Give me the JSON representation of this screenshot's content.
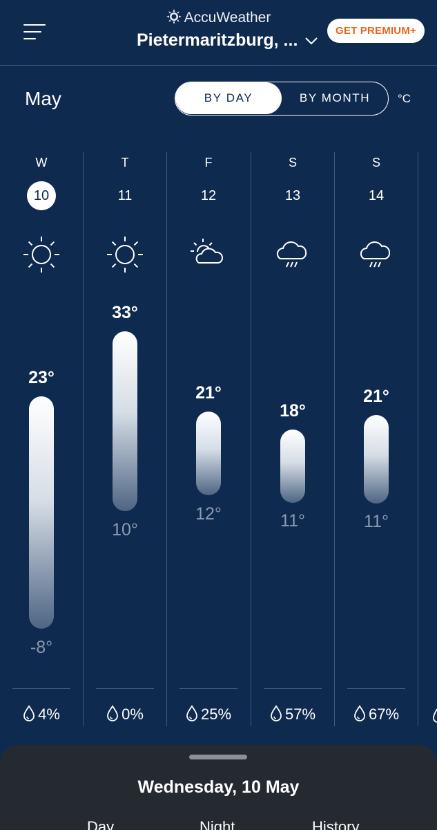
{
  "header": {
    "brand": "AccuWeather",
    "location": "Pietermaritzburg, ...",
    "premium_label": "GET PREMIUM+"
  },
  "month": {
    "title": "May",
    "toggle": {
      "by_day": "BY DAY",
      "by_month": "BY MONTH",
      "selected": "BY DAY"
    },
    "unit": "°C"
  },
  "days": [
    {
      "dow": "W",
      "date": "10",
      "selected": true,
      "icon": "sunny-icon",
      "hi": "23°",
      "lo": "-8°",
      "precip": "4%"
    },
    {
      "dow": "T",
      "date": "11",
      "selected": false,
      "icon": "sunny-icon",
      "hi": "33°",
      "lo": "10°",
      "precip": "0%"
    },
    {
      "dow": "F",
      "date": "12",
      "selected": false,
      "icon": "partly-sunny-icon",
      "hi": "21°",
      "lo": "12°",
      "precip": "25%"
    },
    {
      "dow": "S",
      "date": "13",
      "selected": false,
      "icon": "showers-icon",
      "hi": "18°",
      "lo": "11°",
      "precip": "57%"
    },
    {
      "dow": "S",
      "date": "14",
      "selected": false,
      "icon": "showers-icon",
      "hi": "21°",
      "lo": "11°",
      "precip": "67%"
    }
  ],
  "sheet": {
    "title": "Wednesday, 10 May",
    "tabs": [
      "Day",
      "Night",
      "History"
    ]
  },
  "colors": {
    "background": "#0e2a4e",
    "premium_text": "#e8641c",
    "sheet": "#252a31",
    "low_temp": "#8c9bb0"
  }
}
